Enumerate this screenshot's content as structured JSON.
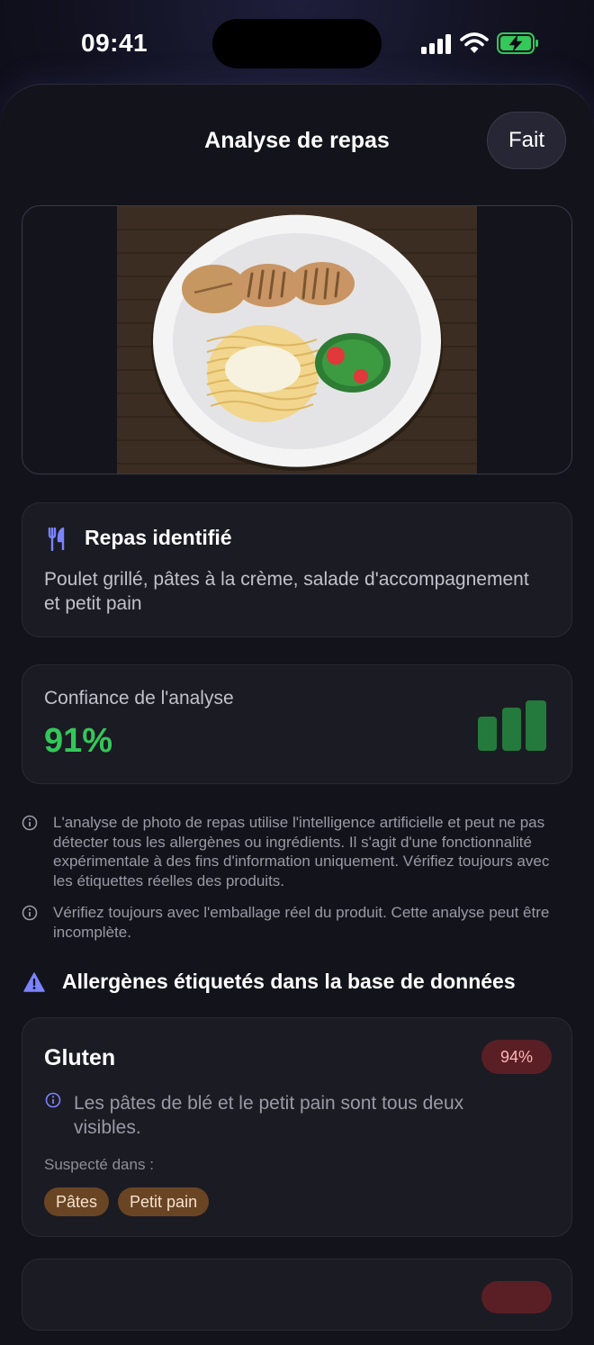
{
  "status_bar": {
    "time": "09:41"
  },
  "header": {
    "title": "Analyse de repas",
    "done_label": "Fait"
  },
  "meal": {
    "title": "Repas identifié",
    "description": "Poulet grillé, pâtes à la crème, salade d'accompagnement et petit pain"
  },
  "confidence": {
    "label": "Confiance de l'analyse",
    "value": "91%",
    "level": 0.91,
    "color": "#34c759"
  },
  "disclaimers": [
    "L'analyse de photo de repas utilise l'intelligence artificielle et peut ne pas détecter tous les allergènes ou ingrédients. Il s'agit d'une fonctionnalité expérimentale à des fins d'information uniquement. Vérifiez toujours avec les étiquettes réelles des produits.",
    "Vérifiez toujours avec l'emballage réel du produit. Cette analyse peut être incomplète."
  ],
  "allergens_section": {
    "title": "Allergènes étiquetés dans la base de données"
  },
  "allergens": [
    {
      "name": "Gluten",
      "confidence": "94%",
      "reason": "Les pâtes de blé et le petit pain sont tous deux visibles.",
      "suspected_label": "Suspecté dans :",
      "suspected_in": [
        "Pâtes",
        "Petit pain"
      ]
    }
  ],
  "icons": {
    "meal": "fork-knife-icon",
    "info": "info-circle-icon",
    "warning": "warning-triangle-icon",
    "confidence": "signal-bars-icon"
  },
  "colors": {
    "accent": "#7b83ff",
    "success": "#34c759",
    "badge_bg": "#5a1f25",
    "chip_bg": "#6a4524"
  }
}
